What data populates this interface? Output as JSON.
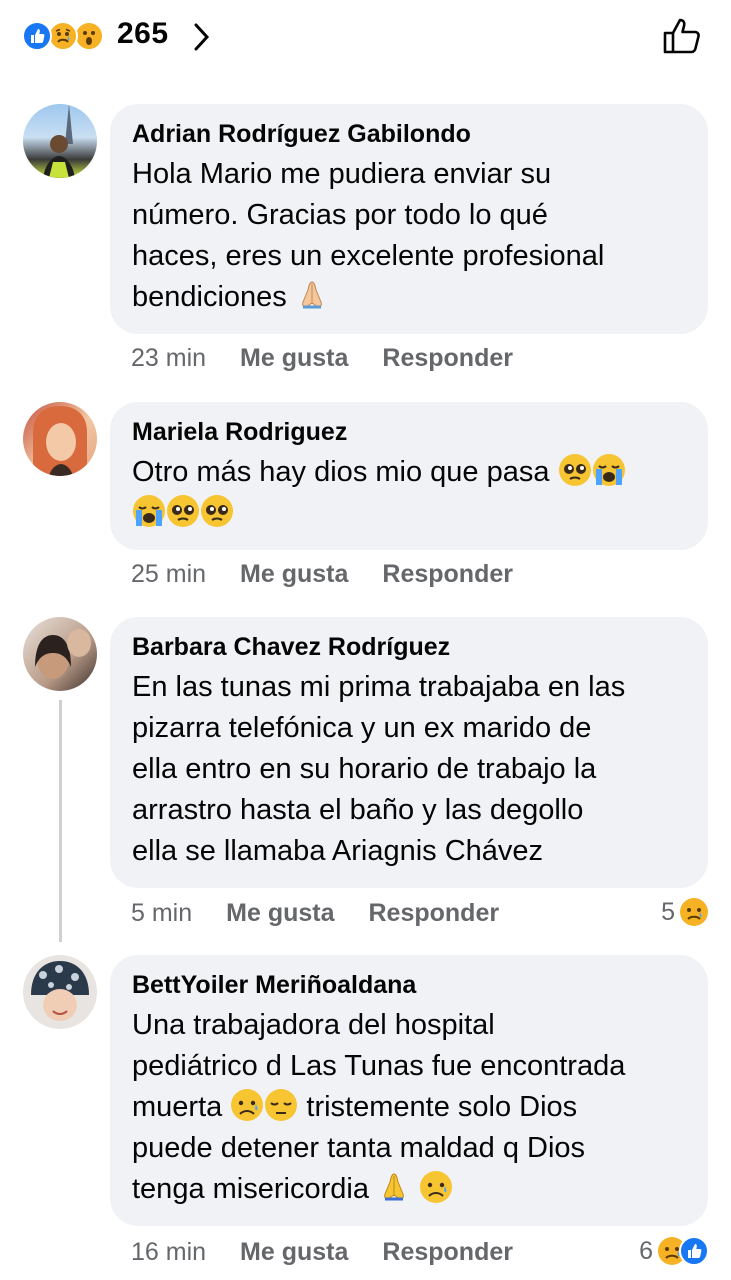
{
  "reactions": {
    "count": "265",
    "types": [
      "like-icon",
      "sad-icon",
      "wow-icon"
    ]
  },
  "comments": [
    {
      "author": "Adrian Rodríguez Gabilondo",
      "lines": [
        "Hola Mario me pudiera enviar su",
        "número. Gracias por todo lo qué",
        "haces, eres un excelente profesional",
        "bendiciones"
      ],
      "time": "23 min",
      "like_label": "Me gusta",
      "reply_label": "Responder"
    },
    {
      "author": "Mariela Rodriguez",
      "lines": [
        "Otro más hay dios mio que pasa"
      ],
      "time": "25 min",
      "like_label": "Me gusta",
      "reply_label": "Responder"
    },
    {
      "author": "Barbara Chavez Rodríguez",
      "lines": [
        "En las tunas mi prima trabajaba en las",
        "pizarra telefónica y un ex marido de",
        "ella entro en su horario de trabajo la",
        "arrastro hasta el baño y las degollo",
        "ella se llamaba Ariagnis Chávez"
      ],
      "time": "5 min",
      "like_label": "Me gusta",
      "reply_label": "Responder",
      "reaction_count": "5"
    },
    {
      "author": "BettYoiler Meriñoaldana",
      "lines": [
        "Una trabajadora del hospital",
        "pediátrico d Las Tunas fue encontrada",
        "muerta",
        "tristemente solo Dios",
        "puede detener tanta maldad q Dios",
        "tenga misericordia"
      ],
      "time": "16 min",
      "like_label": "Me gusta",
      "reply_label": "Responder",
      "reaction_count": "6"
    }
  ],
  "colors": {
    "bubble": "#f0f2f5",
    "meta": "#65676b",
    "like_blue": "#1877f2",
    "emoji_yellow": "#f7b125"
  }
}
